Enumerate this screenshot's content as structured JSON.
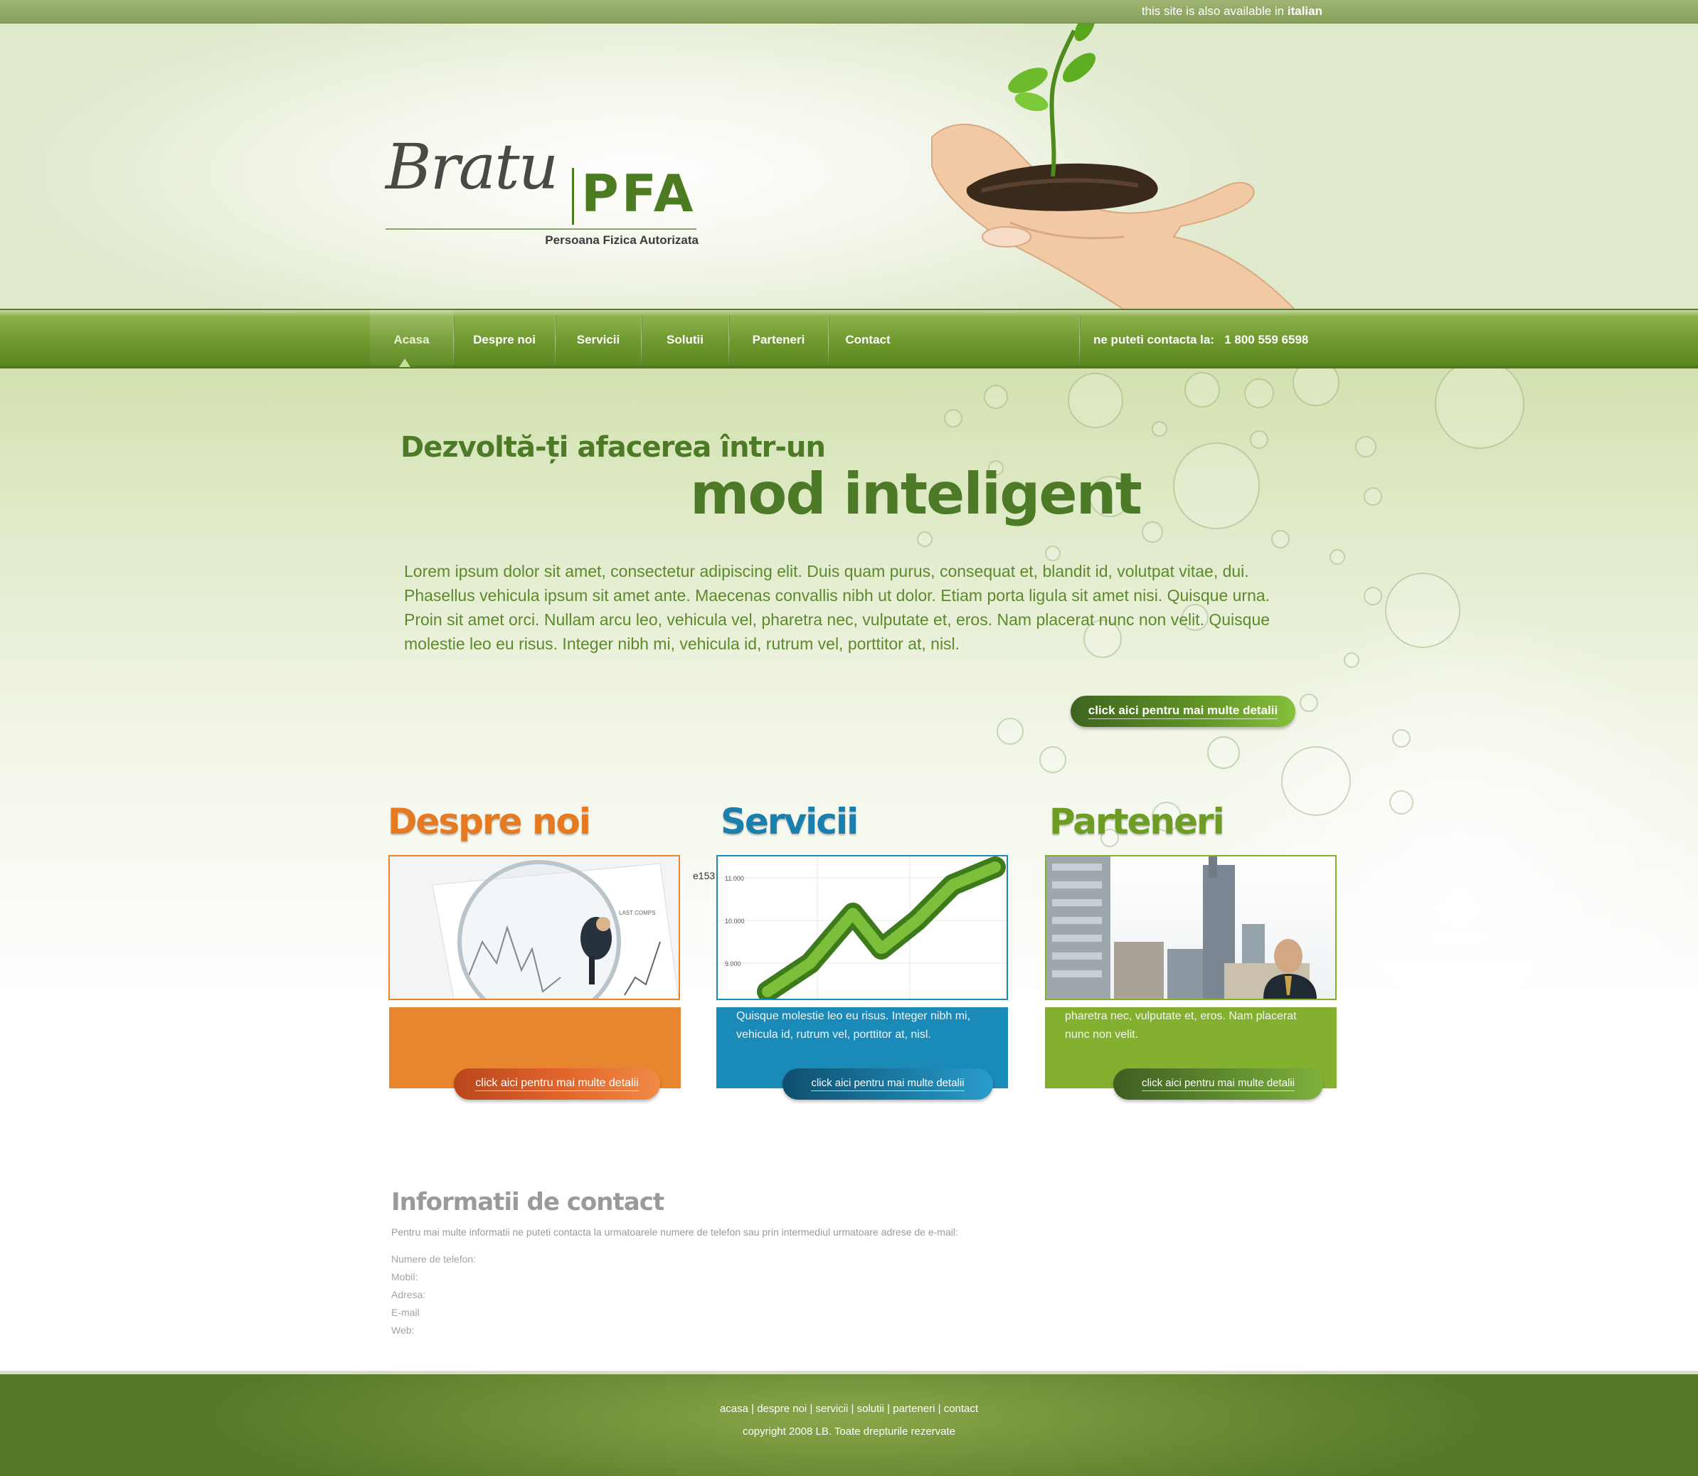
{
  "topbar": {
    "lang_prefix": "this site is also available in",
    "lang_link": "italian"
  },
  "logo": {
    "script": "Bratu",
    "mark": "PFA",
    "subtitle": "Persoana Fizica Autorizata"
  },
  "nav": {
    "items": [
      "Acasa",
      "Despre noi",
      "Servicii",
      "Solutii",
      "Parteneri",
      "Contact"
    ],
    "active": "Acasa",
    "contact_label": "ne puteti contacta la:",
    "phone": "1 800 559 6598"
  },
  "hero": {
    "headline_small": "Dezvoltă-ți afacerea într-un",
    "headline_large": "mod inteligent",
    "body": "Lorem ipsum dolor sit amet, consectetur adipiscing elit. Duis quam purus, consequat et, blandit id, volutpat vitae, dui. Phasellus vehicula ipsum sit amet ante. Maecenas convallis nibh ut dolor. Etiam porta ligula sit amet nisi. Quisque urna. Proin sit amet orci. Nullam arcu leo, vehicula vel, pharetra nec, vulputate et, eros. Nam placerat nunc non velit. Quisque molestie leo eu risus. Integer nibh mi, vehicula id, rutrum vel, porttitor at, nisl.",
    "button": "click aici pentru mai multe detalii"
  },
  "sections": [
    {
      "title": "Despre noi",
      "color": "#e8862f",
      "title_color": "#e57a22",
      "text": "",
      "button": "click aici pentru mai multe detalii"
    },
    {
      "title": "Servicii",
      "color": "#1a8ab8",
      "title_color": "#1b7fae",
      "text": "Quisque molestie leo eu risus. Integer nibh mi, vehicula id, rutrum vel, porttitor at, nisl.",
      "button": "click aici pentru mai multe detalii"
    },
    {
      "title": "Parteneri",
      "color": "#84b030",
      "title_color": "#6e9d24",
      "text": "pharetra nec, vulputate et, eros. Nam placerat nunc non velit.",
      "button": "click aici pentru mai multe detalii"
    }
  ],
  "chart_thumb": {
    "stray_label": "e153",
    "ticks": [
      "11.000",
      "10.000",
      "9.000"
    ],
    "magnifier_label": "LAST COMPS"
  },
  "contact": {
    "title": "Informatii de contact",
    "description": "Pentru mai multe informatii ne puteti contacta la urmatoarele numere de telefon sau prin intermediul urmatoare adrese de e-mail:",
    "fields": [
      "Numere de telefon:",
      "Mobil:",
      "Adresa:",
      "E-mail",
      "Web:"
    ]
  },
  "footer": {
    "links": [
      "acasa",
      "despre noi",
      "servicii",
      "solutii",
      "parteneri",
      "contact"
    ],
    "copyright": "copyright 2008 LB. Toate drepturile rezervate"
  },
  "colors": {
    "brand_green": "#4c7b22",
    "nav_green": "#6f9a2f",
    "orange": "#e8862f",
    "blue": "#1a8ab8",
    "lime": "#84b030"
  }
}
